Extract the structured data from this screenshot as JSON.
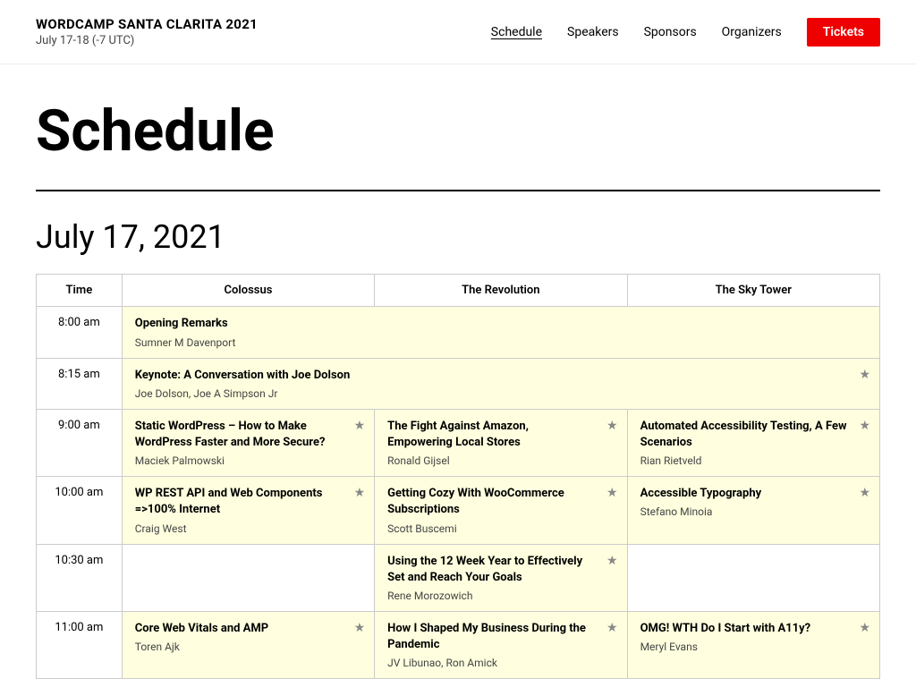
{
  "header": {
    "site_title": "WORDCAMP SANTA CLARITA 2021",
    "site_subtitle": "July 17-18 (-7 UTC)",
    "nav": {
      "schedule": "Schedule",
      "speakers": "Speakers",
      "sponsors": "Sponsors",
      "organizers": "Organizers",
      "tickets": "Tickets"
    }
  },
  "page": {
    "title": "Schedule"
  },
  "section": {
    "date": "July 17, 2021"
  },
  "columns": {
    "time": "Time",
    "colossus": "Colossus",
    "revolution": "The Revolution",
    "skytower": "The Sky Tower"
  },
  "rows": [
    {
      "time": "8:00 am",
      "type": "full",
      "title": "Opening Remarks",
      "speaker": "Sumner M Davenport"
    },
    {
      "time": "8:15 am",
      "type": "full",
      "title": "Keynote: A Conversation with Joe Dolson",
      "speaker": "Joe Dolson, Joe A Simpson Jr",
      "star": true
    },
    {
      "time": "9:00 am",
      "type": "split",
      "colossus": {
        "title": "Static WordPress – How to Make WordPress Faster and More Secure?",
        "speaker": "Maciek Palmowski",
        "star": true
      },
      "revolution": {
        "title": "The Fight Against Amazon, Empowering Local Stores",
        "speaker": "Ronald Gijsel",
        "star": true
      },
      "skytower": {
        "title": "Automated Accessibility Testing, A Few Scenarios",
        "speaker": "Rian Rietveld",
        "star": true
      }
    },
    {
      "time": "10:00 am",
      "type": "split",
      "colossus": {
        "title": "WP REST API and Web Components =>100% Internet",
        "speaker": "Craig West",
        "star": true
      },
      "revolution": {
        "title": "Getting Cozy With WooCommerce Subscriptions",
        "speaker": "Scott Buscemi",
        "star": true
      },
      "skytower": {
        "title": "Accessible Typography",
        "speaker": "Stefano Minoia",
        "star": true
      }
    },
    {
      "time": "10:30 am",
      "type": "revolution-only",
      "revolution": {
        "title": "Using the 12 Week Year to Effectively Set and Reach Your Goals",
        "speaker": "Rene Morozowich",
        "star": true
      }
    },
    {
      "time": "11:00 am",
      "type": "split",
      "colossus": {
        "title": "Core Web Vitals and AMP",
        "speaker": "Toren Ajk",
        "star": true
      },
      "revolution": {
        "title": "How I Shaped My Business During the Pandemic",
        "speaker": "JV Libunao, Ron Amick",
        "star": true
      },
      "skytower": {
        "title": "OMG! WTH Do I Start with A11y?",
        "speaker": "Meryl Evans",
        "star": true
      }
    }
  ]
}
